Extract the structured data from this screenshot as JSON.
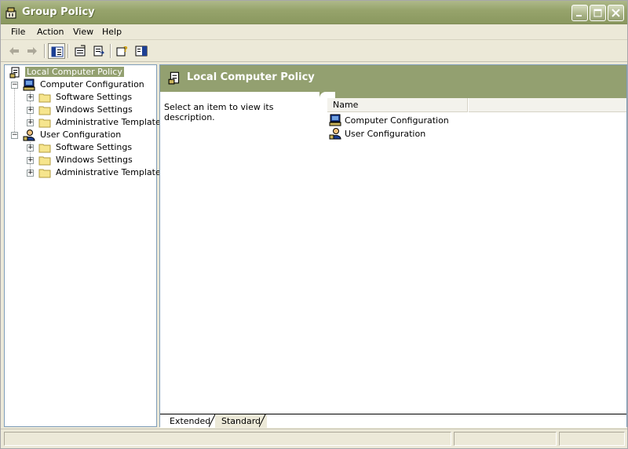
{
  "window": {
    "title": "Group Policy"
  },
  "menu": [
    "File",
    "Action",
    "View",
    "Help"
  ],
  "tree": {
    "root": "Local Computer Policy",
    "computer": {
      "label": "Computer Configuration",
      "children": [
        "Software Settings",
        "Windows Settings",
        "Administrative Templates"
      ]
    },
    "user": {
      "label": "User Configuration",
      "children": [
        "Software Settings",
        "Windows Settings",
        "Administrative Templates"
      ]
    }
  },
  "right": {
    "header_title": "Local Computer Policy",
    "description": "Select an item to view its description.",
    "columns": [
      "Name"
    ],
    "rows": [
      "Computer Configuration",
      "User Configuration"
    ]
  },
  "tabs": [
    "Extended",
    "Standard"
  ],
  "colors": {
    "accent": "#93a070",
    "titlebar": "#97a46c"
  },
  "icons": {
    "toolbar": [
      "back-arrow-icon",
      "forward-arrow-icon",
      "show-hide-tree-icon",
      "properties-icon",
      "export-list-icon",
      "help-icon",
      "show-hide-action-pane-icon"
    ]
  }
}
